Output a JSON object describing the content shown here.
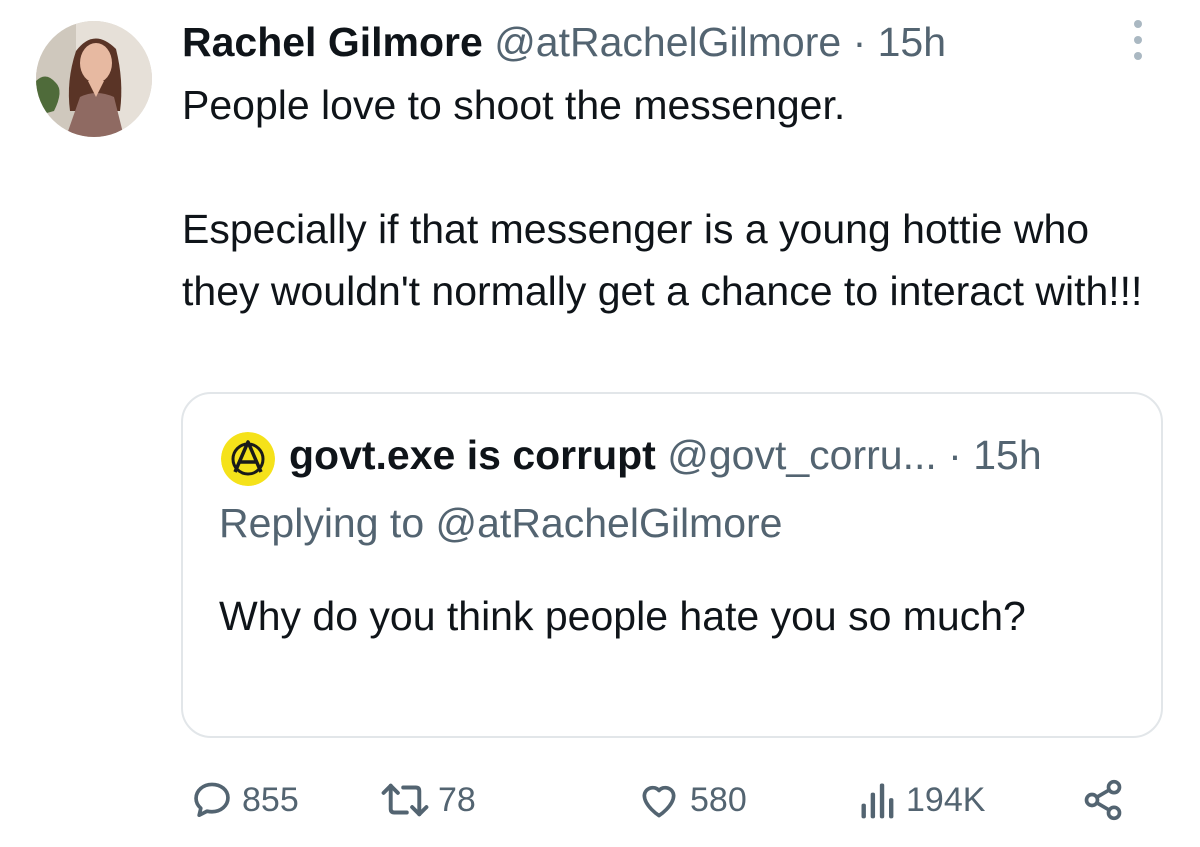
{
  "tweet": {
    "display_name": "Rachel Gilmore",
    "handle": "@atRachelGilmore",
    "separator": "·",
    "time": "15h",
    "text_line1": "People love to shoot the messenger.",
    "text_para2": "Especially if that messenger is a young hottie who they wouldn't normally get a chance to interact with!!!"
  },
  "quote": {
    "display_name": "govt.exe is corrupt",
    "handle": "@govt_corru...",
    "separator": "·",
    "time": "15h",
    "replying_to": "Replying to @atRachelGilmore",
    "text": "Why do you think people hate you so much?"
  },
  "actions": {
    "replies": "855",
    "reposts": "78",
    "likes": "580",
    "views": "194K"
  },
  "icons": {
    "more": "more-vertical-icon",
    "reply": "speech-bubble-icon",
    "repost": "repost-arrows-icon",
    "like": "heart-icon",
    "views": "bar-chart-icon",
    "share": "share-nodes-icon"
  },
  "colors": {
    "text_primary": "#0f1419",
    "text_secondary": "#536471",
    "border": "#e2e6e9",
    "quote_avatar_bg": "#f5e21a"
  }
}
